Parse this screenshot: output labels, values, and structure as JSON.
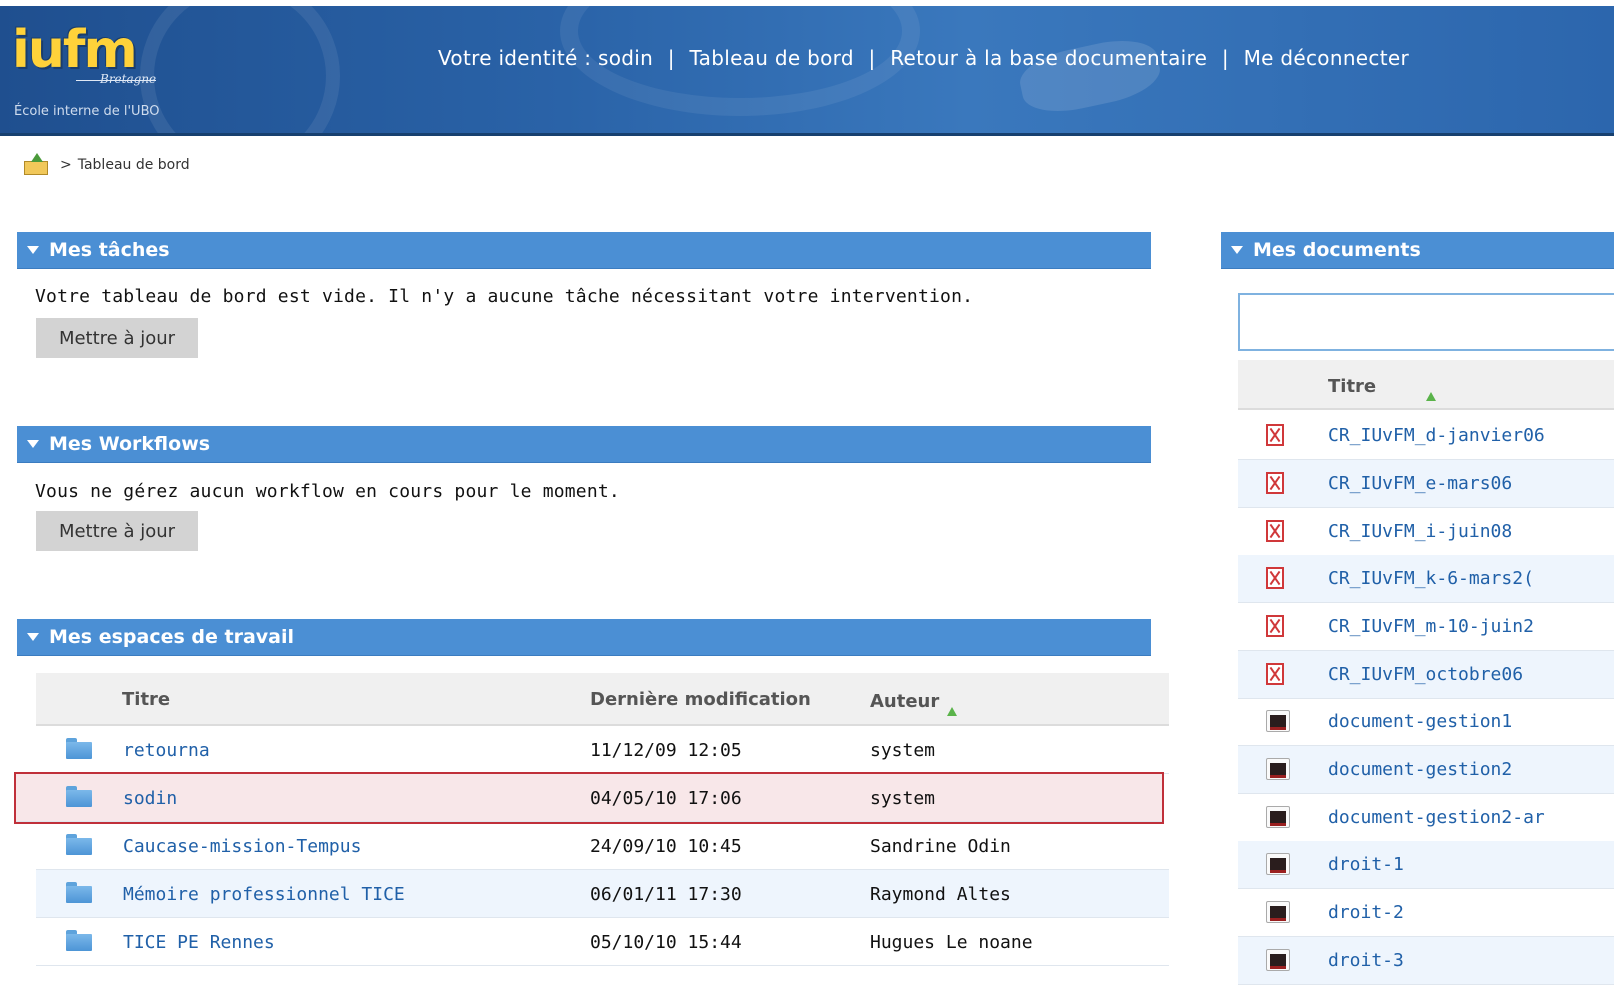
{
  "header": {
    "logo_text": "iufm",
    "logo_sub": "Bretagne",
    "school": "École interne de l'UBO",
    "identity_label": "Votre identité : sodin",
    "dashboard_link": "Tableau de bord",
    "back_link": "Retour à la base documentaire",
    "logout_link": "Me déconnecter",
    "separator": "|"
  },
  "breadcrumb": {
    "separator": ">",
    "current": "Tableau de bord"
  },
  "tasks": {
    "title": "Mes tâches",
    "message": "Votre tableau de bord est vide. Il n'y a aucune tâche nécessitant votre intervention.",
    "button": "Mettre à jour"
  },
  "workflows": {
    "title": "Mes Workflows",
    "message": "Vous ne gérez aucun workflow en cours pour le moment.",
    "button": "Mettre à jour"
  },
  "workspaces": {
    "title": "Mes espaces de travail",
    "col_title": "Titre",
    "col_modified": "Dernière modification",
    "col_author": "Auteur",
    "rows": [
      {
        "title": "retourna",
        "modified": "11/12/09 12:05",
        "author": "system"
      },
      {
        "title": "sodin",
        "modified": "04/05/10 17:06",
        "author": "system"
      },
      {
        "title": "Caucase-mission-Tempus",
        "modified": "24/09/10 10:45",
        "author": "Sandrine Odin"
      },
      {
        "title": "Mémoire professionnel TICE",
        "modified": "06/01/11 17:30",
        "author": "Raymond Altes"
      },
      {
        "title": "TICE PE Rennes",
        "modified": "05/10/10 15:44",
        "author": "Hugues Le noane"
      }
    ]
  },
  "documents": {
    "title": "Mes documents",
    "search_value": "",
    "col_title": "Titre",
    "rows": [
      {
        "name": "CR_IUvFM_d-janvier06",
        "icon": "pdf-icon"
      },
      {
        "name": "CR_IUvFM_e-mars06",
        "icon": "pdf-icon"
      },
      {
        "name": "CR_IUvFM_i-juin08",
        "icon": "pdf-icon"
      },
      {
        "name": "CR_IUvFM_k-6-mars2(",
        "icon": "pdf-icon"
      },
      {
        "name": "CR_IUvFM_m-10-juin2",
        "icon": "pdf-icon"
      },
      {
        "name": "CR_IUvFM_octobre06",
        "icon": "pdf-icon"
      },
      {
        "name": "document-gestion1",
        "icon": "document-icon"
      },
      {
        "name": "document-gestion2",
        "icon": "document-icon"
      },
      {
        "name": "document-gestion2-ar",
        "icon": "document-icon"
      },
      {
        "name": "droit-1",
        "icon": "document-icon"
      },
      {
        "name": "droit-2",
        "icon": "document-icon"
      },
      {
        "name": "droit-3",
        "icon": "document-icon"
      }
    ]
  },
  "colors": {
    "header_bg": "#2a63a8",
    "panel_bar": "#4b8fd4",
    "link": "#2060a8",
    "selected_row_border": "#c0303a",
    "logo_yellow": "#ffd23a"
  }
}
